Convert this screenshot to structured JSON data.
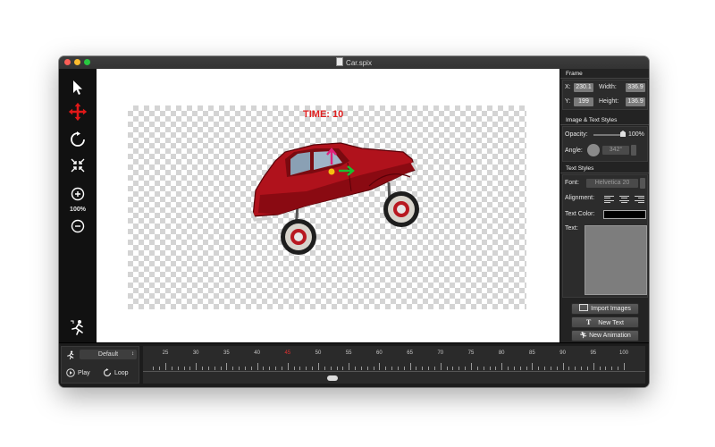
{
  "window": {
    "title": "Car.spix"
  },
  "toolbar": {
    "select_icon": "arrow-cursor-icon",
    "move_icon": "move-arrows-icon",
    "rotate_icon": "rotate-icon",
    "scale_icon": "shrink-icon",
    "zoom_in_icon": "zoom-in-icon",
    "zoom_out_icon": "zoom-out-icon",
    "zoom_level": "100%",
    "animation_icon": "running-figure-icon"
  },
  "canvas": {
    "time_text": "TIME: 10"
  },
  "inspector": {
    "frame": {
      "heading": "Frame",
      "x_label": "X:",
      "x_value": "230.1",
      "y_label": "Y:",
      "y_value": "199",
      "width_label": "Width:",
      "width_value": "336.9",
      "height_label": "Height:",
      "height_value": "136.9"
    },
    "image_text_styles": {
      "heading": "Image & Text Styles",
      "opacity_label": "Opacity:",
      "opacity_value": "100%",
      "angle_label": "Angle:",
      "angle_value": "342°"
    },
    "text_styles": {
      "heading": "Text Styles",
      "font_label": "Font:",
      "font_value": "Helvetica 20",
      "alignment_label": "Alignment:",
      "text_color_label": "Text Color:",
      "text_label": "Text:"
    },
    "buttons": {
      "import_images": "Import Images",
      "new_text": "New Text",
      "new_animation": "New Animation"
    }
  },
  "bottom": {
    "animation_select": "Default",
    "play_label": "Play",
    "loop_label": "Loop",
    "ruler_labels": [
      "25",
      "30",
      "35",
      "40",
      "45",
      "50",
      "55",
      "60",
      "65",
      "70",
      "75",
      "80",
      "85",
      "90",
      "95",
      "100"
    ],
    "current_frame": "45",
    "accent_current": "#e03030"
  }
}
